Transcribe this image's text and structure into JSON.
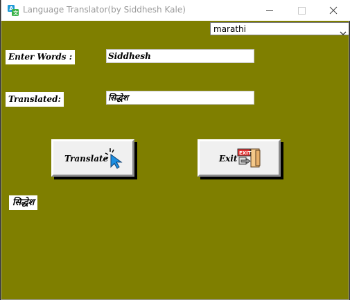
{
  "window": {
    "title": "Language Translator(by Siddhesh Kale)",
    "background": "#7f7f00",
    "controls": [
      "minimize-icon",
      "maximize-icon",
      "close-icon"
    ]
  },
  "language_select": {
    "selected": "marathi"
  },
  "form": {
    "enter_label": "Enter Words :",
    "enter_value": "Siddhesh",
    "translated_label": "Translated:",
    "translated_value": "सिद्धेश"
  },
  "buttons": {
    "translate_label": "Translate",
    "translate_icon": "cursor-click-icon",
    "exit_label": "Exit",
    "exit_icon": "exit-door-icon"
  },
  "output": {
    "text": "सिद्धेश"
  }
}
